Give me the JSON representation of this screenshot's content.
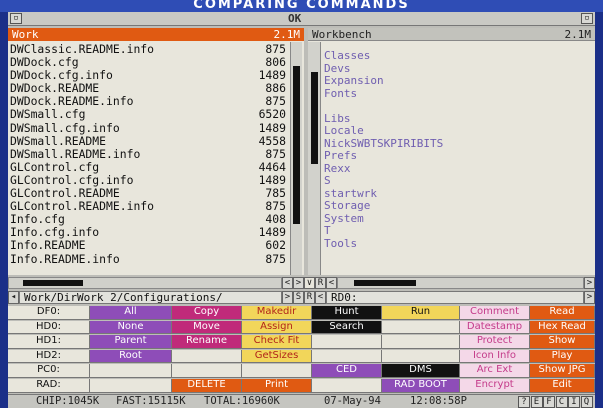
{
  "banner": {
    "text": "COMPARING COMMANDS"
  },
  "titlebar": {
    "ok_label": "OK"
  },
  "left_lister": {
    "title": "Work",
    "total": "2.1M",
    "files": [
      {
        "name": "DWClassic.README.info",
        "size": "875"
      },
      {
        "name": "DWDock.cfg",
        "size": "806"
      },
      {
        "name": "DWDock.cfg.info",
        "size": "1489"
      },
      {
        "name": "DWDock.README",
        "size": "886"
      },
      {
        "name": "DWDock.README.info",
        "size": "875"
      },
      {
        "name": "DWSmall.cfg",
        "size": "6520"
      },
      {
        "name": "DWSmall.cfg.info",
        "size": "1489"
      },
      {
        "name": "DWSmall.README",
        "size": "4558"
      },
      {
        "name": "DWSmall.README.info",
        "size": "875"
      },
      {
        "name": "GLControl.cfg",
        "size": "4464"
      },
      {
        "name": "GLControl.cfg.info",
        "size": "1489"
      },
      {
        "name": "GLControl.README",
        "size": "785"
      },
      {
        "name": "GLControl.README.info",
        "size": "875"
      },
      {
        "name": "Info.cfg",
        "size": "408"
      },
      {
        "name": "Info.cfg.info",
        "size": "1489"
      },
      {
        "name": "Info.README",
        "size": "602"
      },
      {
        "name": "Info.README.info",
        "size": "875"
      }
    ],
    "path": "Work/DirWork_2/Configurations/"
  },
  "right_lister": {
    "title": "Workbench",
    "total": "2.1M",
    "dirs": [
      "Classes",
      "Devs",
      "Expansion",
      "Fonts",
      "",
      "Libs",
      "Locale",
      "NickSWBTSKPIRIBITS",
      "Prefs",
      "Rexx",
      "S",
      "startwrk",
      "Storage",
      "System",
      "T",
      "Tools"
    ],
    "path": "RD0:"
  },
  "scroll_gadgets": {
    "left": "<",
    "right": ">",
    "s": "S",
    "r": "R"
  },
  "drives": [
    "DF0:",
    "HD0:",
    "HD1:",
    "HD2:",
    "PC0:",
    "RAD:"
  ],
  "buttons": {
    "col1": [
      "All",
      "None",
      "Parent",
      "Root",
      "",
      ""
    ],
    "col2": [
      "Copy",
      "Move",
      "Rename",
      "",
      "",
      "DELETE"
    ],
    "col3": [
      "Makedir",
      "Assign",
      "Check Fit",
      "GetSizes",
      "",
      "Print"
    ],
    "col4": [
      "Hunt",
      "Search",
      "",
      "",
      "CED",
      ""
    ],
    "col5": [
      "Run",
      "",
      "",
      "",
      "DMS",
      "RAD BOOT"
    ],
    "col6": [
      "Comment",
      "Datestamp",
      "Protect",
      "Icon Info",
      "Arc Ext",
      "Encrypt"
    ],
    "col7": [
      "Read",
      "Hex Read",
      "Show",
      "Play",
      "Show JPG",
      "Edit"
    ]
  },
  "colors": {
    "accent_orange": "#e05a12",
    "button_purple": "#8e4db8",
    "button_magenta": "#c02a7a",
    "button_yellow": "#f2d65a",
    "button_black": "#111111",
    "button_pink": "#f4d8e8",
    "dir_text": "#6f5eb0"
  },
  "status": {
    "chip": "CHIP:1045K",
    "fast": "FAST:15115K",
    "total": "TOTAL:16960K",
    "date": "07-May-94",
    "time": "12:08:58P",
    "gadgets": [
      "?",
      "E",
      "F",
      "C",
      "I",
      "Q"
    ]
  }
}
